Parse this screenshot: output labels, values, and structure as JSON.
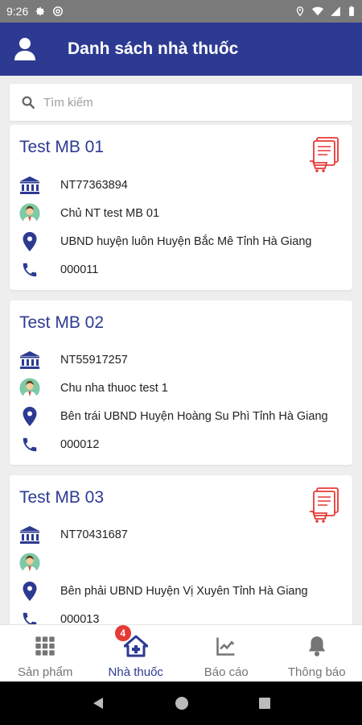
{
  "statusbar": {
    "time": "9:26"
  },
  "header": {
    "title": "Danh sách nhà thuốc"
  },
  "search": {
    "placeholder": "Tìm kiếm"
  },
  "pharmacies": [
    {
      "name": "Test MB 01",
      "code": "NT77363894",
      "owner": "Chủ NT test MB 01",
      "address": "UBND huyện luôn Huyện Bắc Mê Tỉnh Hà Giang",
      "phone": "000011",
      "has_order": true
    },
    {
      "name": "Test MB 02",
      "code": "NT55917257",
      "owner": "Chu nha thuoc test 1",
      "address": "Bên trái UBND Huyện Hoàng Su Phì Tỉnh Hà Giang",
      "phone": "000012",
      "has_order": false
    },
    {
      "name": "Test MB 03",
      "code": "NT70431687",
      "owner": "",
      "address": "Bên phải UBND Huyện Vị Xuyên Tỉnh Hà Giang",
      "phone": "000013",
      "has_order": true
    }
  ],
  "bottom_nav": [
    {
      "label": "Sản phẩm",
      "icon": "grid-icon"
    },
    {
      "label": "Nhà thuốc",
      "icon": "pharmacy-home-icon",
      "badge": "4",
      "active": true
    },
    {
      "label": "Báo cáo",
      "icon": "chart-icon"
    },
    {
      "label": "Thông báo",
      "icon": "bell-icon"
    }
  ],
  "colors": {
    "primary": "#2d3a92",
    "icon": "#2d3a92",
    "cart": "#e53935"
  }
}
